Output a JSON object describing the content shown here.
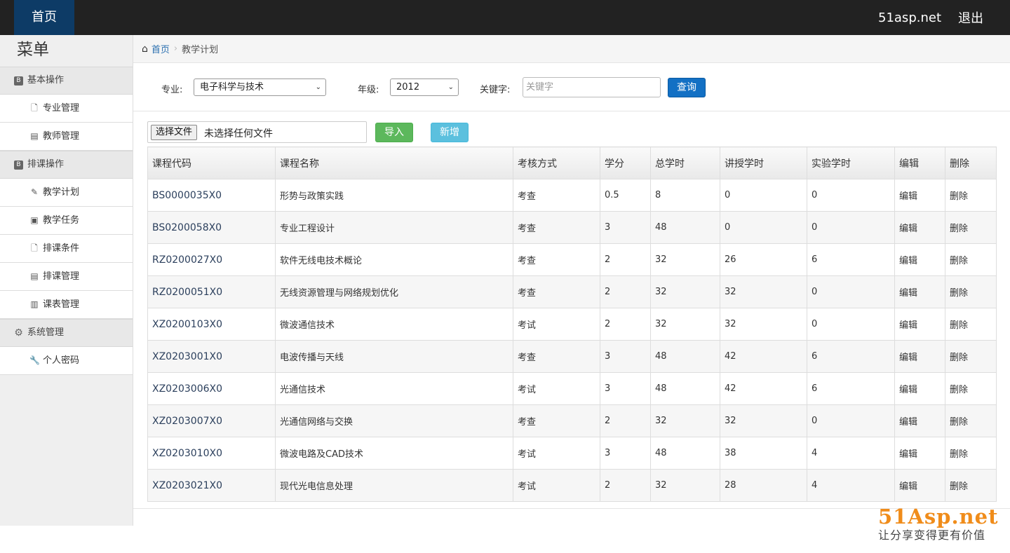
{
  "topbar": {
    "home": "首页",
    "site": "51asp.net",
    "logout": "退出"
  },
  "sidebar": {
    "title": "菜单",
    "groups": [
      {
        "label": "基本操作",
        "items": [
          {
            "label": "专业管理",
            "icon": "file-icon"
          },
          {
            "label": "教师管理",
            "icon": "list-icon"
          }
        ]
      },
      {
        "label": "排课操作",
        "items": [
          {
            "label": "教学计划",
            "icon": "pencil-icon"
          },
          {
            "label": "教学任务",
            "icon": "picture-icon"
          },
          {
            "label": "排课条件",
            "icon": "file-icon"
          },
          {
            "label": "排课管理",
            "icon": "list-icon"
          },
          {
            "label": "课表管理",
            "icon": "books-icon"
          }
        ]
      },
      {
        "label": "系统管理",
        "items": [
          {
            "label": "个人密码",
            "icon": "wrench-icon"
          }
        ]
      }
    ]
  },
  "breadcrumb": {
    "home": "首页",
    "current": "教学计划"
  },
  "filter": {
    "major_label": "专业:",
    "major_value": "电子科学与技术",
    "grade_label": "年级:",
    "grade_value": "2012",
    "keyword_label": "关键字:",
    "keyword_placeholder": "关键字",
    "query_button": "查询"
  },
  "upload": {
    "choose_button": "选择文件",
    "status": "未选择任何文件",
    "import_button": "导入",
    "add_button": "新增"
  },
  "table": {
    "headers": [
      "课程代码",
      "课程名称",
      "考核方式",
      "学分",
      "总学时",
      "讲授学时",
      "实验学时",
      "编辑",
      "删除"
    ],
    "rows": [
      [
        "BS0000035X0",
        "形势与政策实践",
        "考查",
        "0.5",
        "8",
        "0",
        "0",
        "编辑",
        "删除"
      ],
      [
        "BS0200058X0",
        "专业工程设计",
        "考查",
        "3",
        "48",
        "0",
        "0",
        "编辑",
        "删除"
      ],
      [
        "RZ0200027X0",
        "软件无线电技术概论",
        "考查",
        "2",
        "32",
        "26",
        "6",
        "编辑",
        "删除"
      ],
      [
        "RZ0200051X0",
        "无线资源管理与网络规划优化",
        "考查",
        "2",
        "32",
        "32",
        "0",
        "编辑",
        "删除"
      ],
      [
        "XZ0200103X0",
        "微波通信技术",
        "考试",
        "2",
        "32",
        "32",
        "0",
        "编辑",
        "删除"
      ],
      [
        "XZ0203001X0",
        "电波传播与天线",
        "考查",
        "3",
        "48",
        "42",
        "6",
        "编辑",
        "删除"
      ],
      [
        "XZ0203006X0",
        "光通信技术",
        "考试",
        "3",
        "48",
        "42",
        "6",
        "编辑",
        "删除"
      ],
      [
        "XZ0203007X0",
        "光通信网络与交换",
        "考查",
        "2",
        "32",
        "32",
        "0",
        "编辑",
        "删除"
      ],
      [
        "XZ0203010X0",
        "微波电路及CAD技术",
        "考试",
        "3",
        "48",
        "38",
        "4",
        "编辑",
        "删除"
      ],
      [
        "XZ0203021X0",
        "现代光电信息处理",
        "考试",
        "2",
        "32",
        "28",
        "4",
        "编辑",
        "删除"
      ]
    ]
  },
  "watermark": {
    "logo": "51Asp.net",
    "slogan": "让分享变得更有价值"
  }
}
